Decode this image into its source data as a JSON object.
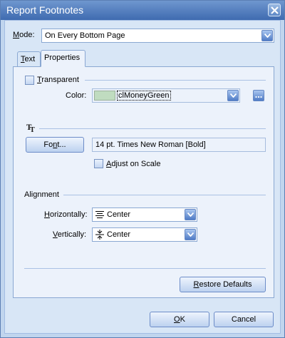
{
  "window": {
    "title": "Report Footnotes"
  },
  "mode": {
    "label_accel": "M",
    "label_rest": "ode:",
    "value": "On Every Bottom Page"
  },
  "tabs": [
    {
      "label": "Text",
      "accel": "T",
      "rest": "ext"
    },
    {
      "label": "Properties"
    }
  ],
  "transparent": {
    "label_accel": "T",
    "label_rest": "ransparent",
    "checked": false
  },
  "color": {
    "label": "Color:",
    "value": "clMoneyGreen",
    "swatch": "#c0dcc0"
  },
  "font": {
    "button_label": "Font...",
    "button_pre": "Fo",
    "button_accel": "n",
    "button_post": "t...",
    "value": "14 pt. Times New Roman  [Bold]"
  },
  "adjust_scale": {
    "label_accel": "A",
    "label_rest": "djust on Scale",
    "checked": false
  },
  "alignment": {
    "heading": "Alignment",
    "horizontal": {
      "label_accel": "H",
      "label_rest": "orizontally:",
      "value": "Center"
    },
    "vertical": {
      "label_accel": "V",
      "label_rest": "ertically:",
      "value": "Center"
    }
  },
  "restore_defaults": {
    "label_accel": "R",
    "label_rest": "estore Defaults"
  },
  "ok": {
    "label_accel": "O",
    "label_rest": "K"
  },
  "cancel": {
    "label": "Cancel"
  }
}
